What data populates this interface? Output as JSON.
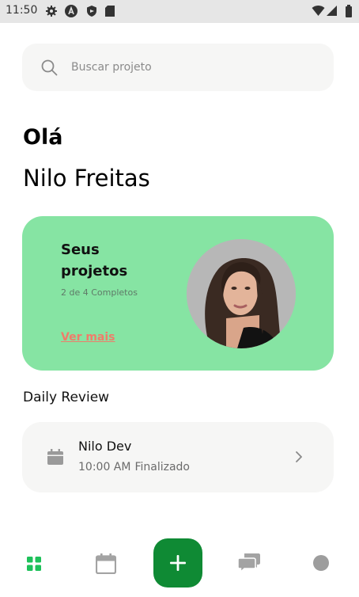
{
  "status_bar": {
    "time": "11:50",
    "icons": [
      "gear-icon",
      "android-auto-icon",
      "shield-icon",
      "sd-card-icon",
      "wifi-icon",
      "signal-icon",
      "battery-icon"
    ]
  },
  "search": {
    "placeholder": "Buscar projeto",
    "value": ""
  },
  "greeting": {
    "hello": "Olá",
    "name": "Nilo Freitas"
  },
  "projects_card": {
    "title": "Seus projetos",
    "progress": "2 de 4 Completos",
    "completed": 2,
    "total": 4,
    "link_label": "Ver mais",
    "background_color": "#86e4a3",
    "link_color": "#ef7d6a"
  },
  "daily_review": {
    "title": "Daily Review",
    "items": [
      {
        "title": "Nilo Dev",
        "time": "10:00 AM",
        "status": "Finalizado",
        "icon": "calendar-icon"
      }
    ]
  },
  "bottom_nav": {
    "items": [
      "home-grid-icon",
      "calendar-icon",
      "add-icon",
      "chat-icon",
      "profile-icon"
    ],
    "active": "home-grid-icon",
    "accent_color": "#0f8a34"
  }
}
